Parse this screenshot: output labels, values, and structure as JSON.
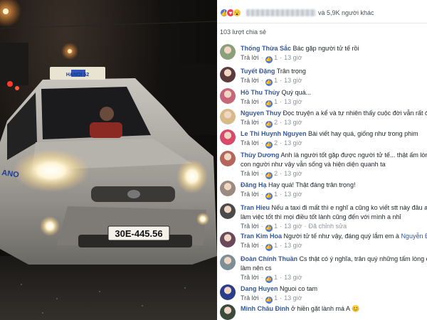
{
  "photo": {
    "plate": "30E-445.56",
    "roof_sign": "HANOI 52",
    "door_text": "ANO"
  },
  "reactions": {
    "icons": [
      "like-icon",
      "love-icon",
      "wow-icon"
    ],
    "others_text": "và 5,9K người khác"
  },
  "shares_text": "103 lượt chia sẻ",
  "comments": [
    {
      "name": "Thống Thừa Sắc",
      "text": "Bác gặp người tử tế rồi",
      "line2": "",
      "reply": "Trả lời",
      "likes": "1",
      "time": "13 giờ",
      "extra": "",
      "avatar_color": "#8aa07a"
    },
    {
      "name": "Tuyết Đặng",
      "text": "Trân trọng",
      "line2": "",
      "reply": "Trả lời",
      "likes": "1",
      "time": "13 giờ",
      "extra": "",
      "avatar_color": "#5b3b3b"
    },
    {
      "name": "Hồ Thu Thủy",
      "text": "Quý quá...",
      "line2": "",
      "reply": "Trả lời",
      "likes": "1",
      "time": "13 giờ",
      "extra": "",
      "avatar_color": "#c7667a"
    },
    {
      "name": "Nguyen Thuy",
      "text": "Đọc truyện a kể và tự nhiên thấy cuộc đời vẫn rất đẹp",
      "line2": "",
      "reply": "Trả lời",
      "likes": "2",
      "time": "13 giờ",
      "extra": "",
      "avatar_color": "#d8b98a"
    },
    {
      "name": "Le Thi Huynh Nguyen",
      "text": "Bài viết hay quá, giống như trong phim",
      "line2": "",
      "reply": "Trả lời",
      "likes": "2",
      "time": "13 giờ",
      "extra": "",
      "avatar_color": "#d9496a"
    },
    {
      "name": "Thùy Dương",
      "text": "Anh là người tốt gặp được người tử tế... thật ấm lòng khi",
      "line2": "con người như vậy vẫn sống và hiện diện quanh ta",
      "reply": "Trả lời",
      "likes": "2",
      "time": "13 giờ",
      "extra": "",
      "avatar_color": "#b4665a"
    },
    {
      "name": "Đăng Hạ",
      "text": "Hay quá! Thật đáng trân trọng!",
      "line2": "",
      "reply": "Trả lời",
      "likes": "1",
      "time": "13 giờ",
      "extra": "",
      "avatar_color": "#9a8a80"
    },
    {
      "name": "Tran Hieu",
      "text": "Nếu a taxi đi mất thì e nghĩ a cũng ko viết stt này đâu a nhỉ",
      "line2": "làm việc tốt thì mọi điều tốt lành cũng đến với mình a nhỉ",
      "reply": "Trả lời",
      "likes": "1",
      "time": "13 giờ",
      "extra": "Đã chỉnh sửa",
      "avatar_color": "#4a4a4a"
    },
    {
      "name": "Tran Kim Hoa",
      "text": "Người tử tế như vậy, đáng quý lắm em à",
      "mention": "Nguyễn Đăng",
      "line2": "",
      "reply": "Trả lời",
      "likes": "1",
      "time": "13 giờ",
      "extra": "",
      "avatar_color": "#6a4a5a"
    },
    {
      "name": "Đoàn Chính Thuần",
      "text": "Cs thật có ý nghĩa, trân quý những tấm lòng của",
      "line2": "làm nên cs",
      "reply": "Trả lời",
      "likes": "1",
      "time": "13 giờ",
      "extra": "",
      "avatar_color": "#7c8f96"
    },
    {
      "name": "Dang Huyen",
      "text": "Nguoi co tam",
      "line2": "",
      "reply": "Trả lời",
      "likes": "1",
      "time": "13 giờ",
      "extra": "",
      "avatar_color": "#2a3d8a"
    },
    {
      "name": "Minh Châu Đinh",
      "text": "ở hiền gặt lành má A 😊",
      "line2": "",
      "reply": "",
      "likes": "",
      "time": "",
      "extra": "",
      "avatar_color": "#3c4a3c"
    }
  ]
}
